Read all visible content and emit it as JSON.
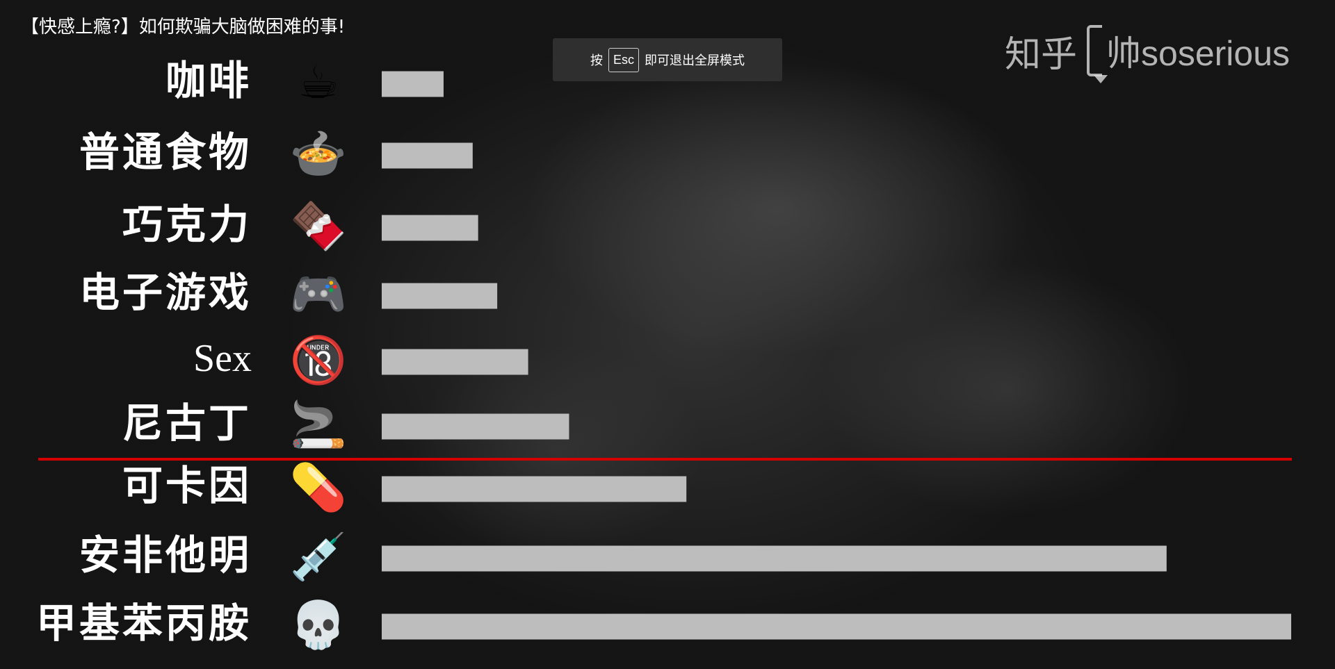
{
  "video_title": "【快感上瘾?】如何欺骗大脑做困难的事!",
  "esc_hint": {
    "before": "按",
    "key": "Esc",
    "after": "即可退出全屏模式"
  },
  "watermark": {
    "site": "知乎",
    "user": "帅soserious"
  },
  "colors": {
    "bar": "#bdbdbd",
    "threshold_line": "#d40000",
    "label": "#ffffff"
  },
  "chart_data": {
    "type": "bar",
    "orientation": "horizontal",
    "categories": [
      "咖啡",
      "普通食物",
      "巧克力",
      "电子游戏",
      "Sex",
      "尼古丁",
      "可卡因",
      "安非他明",
      "甲基苯丙胺"
    ],
    "icons": [
      "hot-beverage-icon",
      "bowl-icon",
      "chocolate-bar-icon",
      "game-controller-icon",
      "no-one-under-eighteen-icon",
      "cigarette-icon",
      "pill-icon",
      "syringe-icon",
      "skull-icon"
    ],
    "icon_glyphs": [
      "☕",
      "🍲",
      "🍫",
      "🎮",
      "🔞",
      "🚬",
      "💊",
      "💉",
      "💀"
    ],
    "values": [
      6.8,
      10.0,
      10.6,
      12.7,
      16.1,
      20.6,
      33.5,
      86.3,
      100
    ],
    "xlim": [
      0,
      100
    ],
    "threshold_after_index": 5,
    "grid": false,
    "title": "",
    "xlabel": "",
    "ylabel": ""
  }
}
